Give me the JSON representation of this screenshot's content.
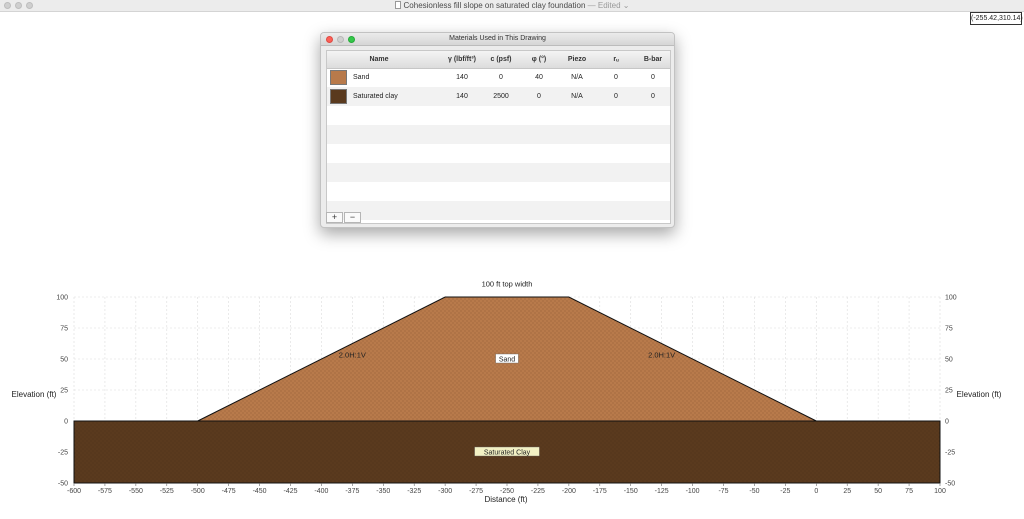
{
  "window": {
    "title": "Cohesionless fill slope on saturated clay foundation",
    "edited": "— Edited ⌄"
  },
  "coordinate_readout": "(-255.42,310.14)",
  "materials_panel": {
    "title": "Materials Used in This Drawing",
    "columns": {
      "name": "Name",
      "gamma": "γ (lbf/ft³)",
      "c": "c (psf)",
      "phi": "φ (°)",
      "piezo": "Piezo",
      "ru": "rᵤ",
      "bbar": "B-bar"
    },
    "rows": [
      {
        "name": "Sand",
        "color": "#b87a4b",
        "gamma": "140",
        "c": "0",
        "phi": "40",
        "piezo": "N/A",
        "ru": "0",
        "bbar": "0"
      },
      {
        "name": "Saturated clay",
        "color": "#5a3a1e",
        "gamma": "140",
        "c": "2500",
        "phi": "0",
        "piezo": "N/A",
        "ru": "0",
        "bbar": "0"
      }
    ],
    "add_label": "+",
    "remove_label": "−"
  },
  "chart_data": {
    "type": "area",
    "xlabel": "Distance (ft)",
    "ylabel_left": "Elevation (ft)",
    "ylabel_right": "Elevation (ft)",
    "xlim": [
      -600,
      100
    ],
    "ylim": [
      -50,
      100
    ],
    "x_ticks": [
      -600,
      -575,
      -550,
      -525,
      -500,
      -475,
      -450,
      -425,
      -400,
      -375,
      -350,
      -325,
      -300,
      -275,
      -250,
      -225,
      -200,
      -175,
      -150,
      -125,
      -100,
      -75,
      -50,
      -25,
      0,
      25,
      50,
      75,
      100
    ],
    "y_ticks": [
      100,
      75,
      50,
      25,
      0,
      -25,
      -50
    ],
    "grid": true,
    "regions": [
      {
        "name": "Sand",
        "label": "Sand",
        "color": "#b87a4b",
        "points": [
          [
            -500,
            0
          ],
          [
            -300,
            100
          ],
          [
            -200,
            100
          ],
          [
            0,
            0
          ]
        ]
      },
      {
        "name": "Saturated Clay",
        "label": "Saturated Clay",
        "color": "#5a3a1e",
        "points": [
          [
            -600,
            0
          ],
          [
            100,
            0
          ],
          [
            100,
            -50
          ],
          [
            -600,
            -50
          ]
        ]
      }
    ],
    "annotations": [
      {
        "text": "100 ft top width",
        "x": -250,
        "y": 110
      },
      {
        "text": "2.0H:1V",
        "x": -375,
        "y": 53
      },
      {
        "text": "2.0H:1V",
        "x": -125,
        "y": 53
      }
    ]
  }
}
